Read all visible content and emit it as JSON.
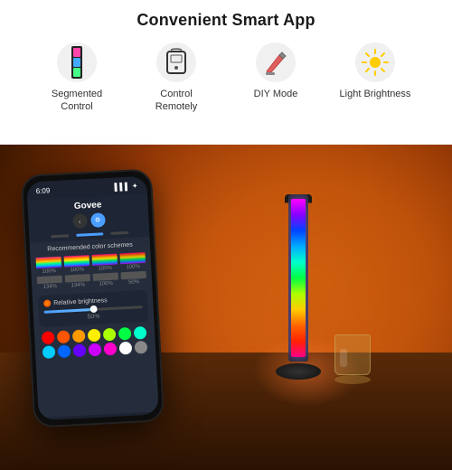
{
  "headline": "Convenient Smart App",
  "features": [
    {
      "id": "segmented-control",
      "label": "Segmented\nControl",
      "icon": "🎛️",
      "icon_char": "▌"
    },
    {
      "id": "control-remotely",
      "label": "Control\nRemotely",
      "icon": "📱",
      "icon_char": "⬜"
    },
    {
      "id": "diy-mode",
      "label": "DIY\nMode",
      "icon": "✏️",
      "icon_char": "✏"
    },
    {
      "id": "light-brightness",
      "label": "Light\nBrightness",
      "icon": "☀️",
      "icon_char": "✦"
    }
  ],
  "phone": {
    "status_time": "6:09",
    "app_name": "Govee",
    "section_title": "Recommended color schemes",
    "brightness_label": "Relative brightness",
    "brightness_pct": "50%",
    "color_columns": [
      [
        "#ff3399",
        "#ff6600",
        "#ffcc00",
        "#00ff88",
        "#00aaff",
        "#8800ff"
      ],
      [
        "#ff0088",
        "#ff8800",
        "#ffee00",
        "#00ee77",
        "#0099ff",
        "#9900ff"
      ],
      [
        "#ee0077",
        "#ee7700",
        "#eedd00",
        "#00dd66",
        "#0088ee",
        "#aa00ee"
      ]
    ],
    "color_dots": [
      "#ff0000",
      "#ff4400",
      "#ff8800",
      "#ffcc00",
      "#ffff00",
      "#88ff00",
      "#00ff00",
      "#00ff88",
      "#00ffcc",
      "#00ffff",
      "#0088ff",
      "#0044ff",
      "#8800ff",
      "#ff00ff"
    ]
  },
  "colors": {
    "bg_warm": "#c45a0a",
    "bg_dark": "#1a0800",
    "white": "#ffffff",
    "text_dark": "#1a1a1a",
    "accent_blue": "#4a9eff"
  }
}
